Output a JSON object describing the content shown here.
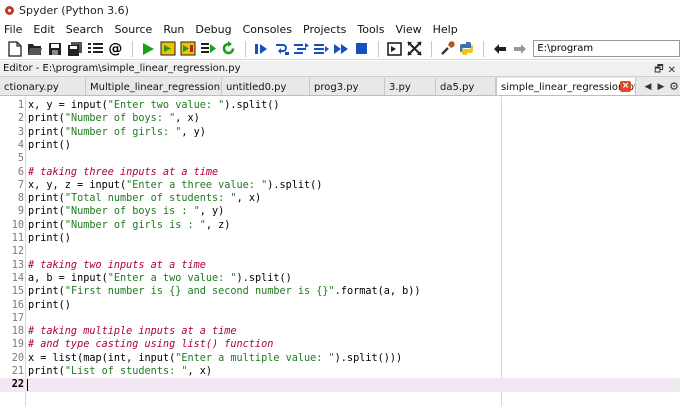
{
  "window": {
    "title": "Spyder (Python 3.6)"
  },
  "menu": [
    "File",
    "Edit",
    "Search",
    "Source",
    "Run",
    "Debug",
    "Consoles",
    "Projects",
    "Tools",
    "View",
    "Help"
  ],
  "toolbar": {
    "path_value": "E:\\program"
  },
  "editor": {
    "title": "Editor - E:\\program\\simple_linear_regression.py",
    "tabs": [
      "ctionary.py",
      "Multiple_linear_regression.py",
      "untitled0.py",
      "prog3.py",
      "3.py",
      "da5.py",
      "simple_linear_regression.py*"
    ],
    "active_tab": 6,
    "current_line": 22
  },
  "code_lines": [
    {
      "n": "1",
      "text": "x, y = input(\"Enter two value: \").split()",
      "comment": false
    },
    {
      "n": "2",
      "text": "print(\"Number of boys: \", x)",
      "comment": false
    },
    {
      "n": "3",
      "text": "print(\"Number of girls: \", y)",
      "comment": false
    },
    {
      "n": "4",
      "text": "print()",
      "comment": false
    },
    {
      "n": "5",
      "text": "",
      "comment": false
    },
    {
      "n": "6",
      "text": "# taking three inputs at a time",
      "comment": true
    },
    {
      "n": "7",
      "text": "x, y, z = input(\"Enter a three value: \").split()",
      "comment": false
    },
    {
      "n": "8",
      "text": "print(\"Total number of students: \", x)",
      "comment": false
    },
    {
      "n": "9",
      "text": "print(\"Number of boys is : \", y)",
      "comment": false
    },
    {
      "n": "10",
      "text": "print(\"Number of girls is : \", z)",
      "comment": false
    },
    {
      "n": "11",
      "text": "print()",
      "comment": false
    },
    {
      "n": "12",
      "text": "",
      "comment": false
    },
    {
      "n": "13",
      "text": "# taking two inputs at a time",
      "comment": true
    },
    {
      "n": "14",
      "text": "a, b = input(\"Enter a two value: \").split()",
      "comment": false
    },
    {
      "n": "15",
      "text": "print(\"First number is {} and second number is {}\".format(a, b))",
      "comment": false
    },
    {
      "n": "16",
      "text": "print()",
      "comment": false
    },
    {
      "n": "17",
      "text": "",
      "comment": false
    },
    {
      "n": "18",
      "text": "# taking multiple inputs at a time",
      "comment": true
    },
    {
      "n": "19",
      "text": "# and type casting using list() function",
      "comment": true
    },
    {
      "n": "20",
      "text": "x = list(map(int, input(\"Enter a multiple value: \").split()))",
      "comment": false
    },
    {
      "n": "21",
      "text": "print(\"List of students: \", x)",
      "comment": false
    },
    {
      "n": "22",
      "text": "",
      "comment": false
    }
  ],
  "icons": [
    "new-file-icon",
    "open-icon",
    "save-icon",
    "save-all-icon",
    "file-list-icon",
    "at-icon",
    "run-icon",
    "run-cell-icon",
    "run-cell-advance-icon",
    "run-selection-icon",
    "rerun-icon",
    "debug-icon",
    "step-icon",
    "step-into-icon",
    "step-return-icon",
    "continue-icon",
    "stop-icon",
    "maximize-pane-icon",
    "fullscreen-icon",
    "preferences-icon",
    "python-path-icon",
    "back-icon",
    "forward-icon"
  ]
}
